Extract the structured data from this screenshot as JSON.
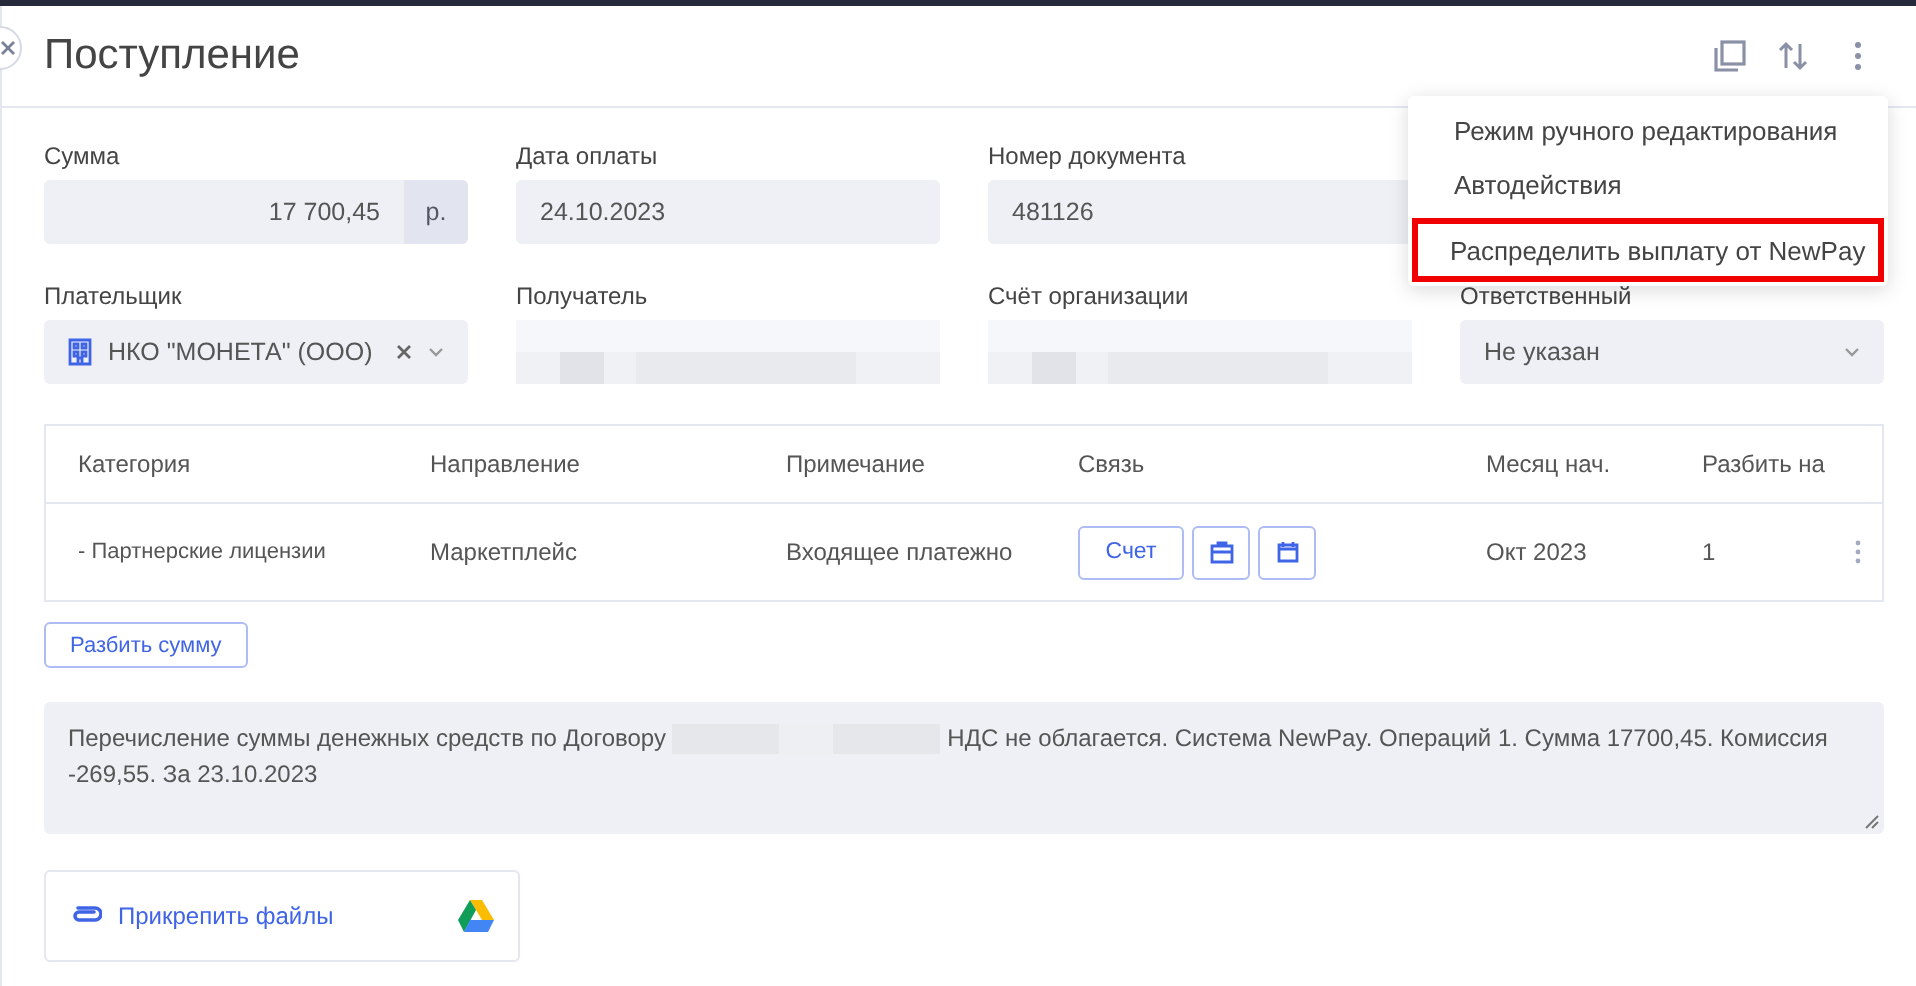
{
  "window": {
    "title": "Поступление"
  },
  "menu": {
    "items": [
      {
        "label": "Режим ручного редактирования",
        "highlighted": false
      },
      {
        "label": "Автодействия",
        "highlighted": false
      },
      {
        "label": "Распределить выплату от NewPay",
        "highlighted": true
      }
    ]
  },
  "fields": [
    {
      "label": "Сумма",
      "kind": "amount",
      "value": "17 700,45",
      "unit": "р."
    },
    {
      "label": "Дата оплаты",
      "kind": "text",
      "value": "24.10.2023"
    },
    {
      "label": "Номер документа",
      "kind": "text",
      "value": "481126"
    },
    {
      "kind": "hidden"
    },
    {
      "label": "Плательщик",
      "kind": "org",
      "value": "НКО \"МОНЕТА\" (ООО)"
    },
    {
      "label": "Получатель",
      "kind": "redacted"
    },
    {
      "label": "Счёт организации",
      "kind": "redacted"
    },
    {
      "label": "Ответственный",
      "kind": "select",
      "value": "Не указан"
    }
  ],
  "table": {
    "columns": [
      "Категория",
      "Направление",
      "Примечание",
      "Связь",
      "Месяц нач.",
      "Разбить на"
    ],
    "rows": [
      {
        "category": "- Партнерские лицензии",
        "direction": "Маркетплейс",
        "note": "Входящее платежно",
        "link_button": "Счет",
        "month": "Окт 2023",
        "split": "1"
      }
    ]
  },
  "split_button": "Разбить сумму",
  "comment": {
    "before": "Перечисление суммы денежных средств по Договору",
    "after": "НДС не облагается. Система NewPay. Операций 1. Сумма 17700,45. Комиссия -269,55. За 23.10.2023"
  },
  "attach": {
    "label": "Прикрепить файлы"
  }
}
